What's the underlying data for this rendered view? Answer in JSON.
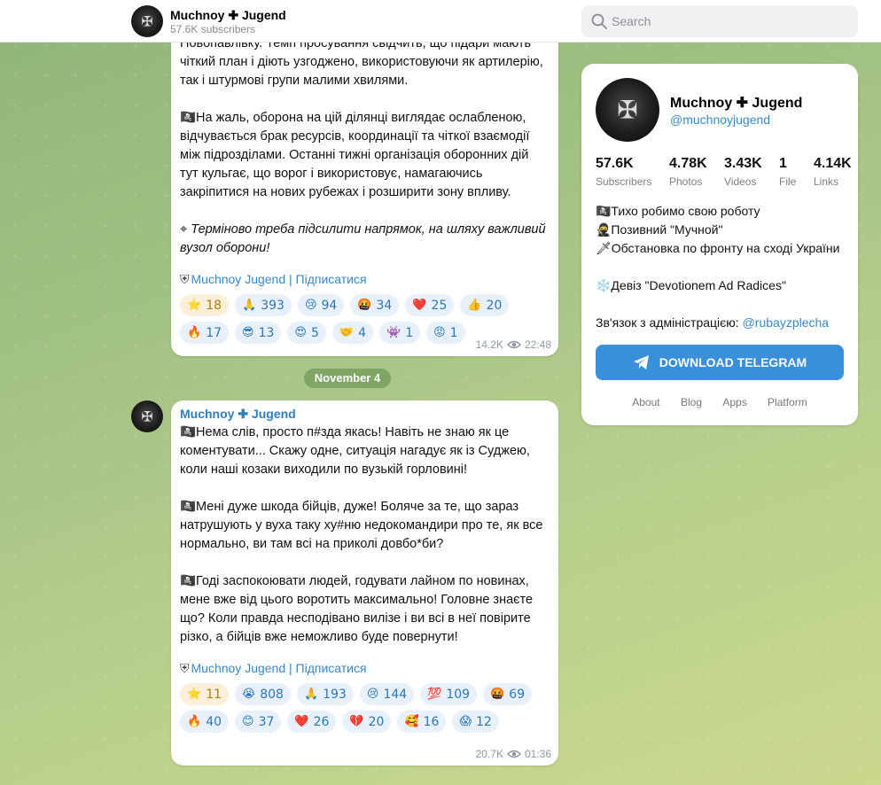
{
  "header": {
    "title": "Muchnoy ✚ Jugend",
    "subscribers": "57.6K subscribers",
    "search_placeholder": "Search"
  },
  "message1": {
    "paragraphs": [
      "Новопавлівку. Темп просування свідчить, що підари мають чіткий план і діють узгоджено, використовуючи як артилерію, так і штурмові групи малими хвилями.",
      "🏴‍☠️На жаль, оборона на цій ділянці виглядає ослабленою, відчувається брак ресурсів, координації та чіткої взаємодії між підрозділами. Останні тижні організація оборонних дій тут кульгає, що ворог і використовує, намагаючись закріпитися на нових рубежах і розширити зону впливу."
    ],
    "italic_prefix": "⌖ ",
    "italic": "Терміново треба підсилити напрямок, на шляху важливий вузол оборони!",
    "link": "Muchnoy Jugend | Підписатися",
    "reactions": [
      {
        "emoji": "⭐",
        "count": "18",
        "star": true
      },
      {
        "emoji": "🙏",
        "count": "393"
      },
      {
        "emoji": "😢",
        "count": "94"
      },
      {
        "emoji": "🤬",
        "count": "34"
      },
      {
        "emoji": "❤️",
        "count": "25"
      },
      {
        "emoji": "👍",
        "count": "20"
      },
      {
        "emoji": "🔥",
        "count": "17"
      },
      {
        "emoji": "😎",
        "count": "13"
      },
      {
        "emoji": "😍",
        "count": "5"
      },
      {
        "emoji": "🤝",
        "count": "4"
      },
      {
        "emoji": "👾",
        "count": "1"
      },
      {
        "emoji": "😡",
        "count": "1"
      }
    ],
    "views": "14.2K",
    "time": "22:48"
  },
  "date_divider": "November 4",
  "message2": {
    "author": "Muchnoy ✚ Jugend",
    "paragraphs": [
      "🏴‍☠️Нема слів, просто п#зда якась! Навіть не знаю як це коментувати... Скажу одне, ситуація нагадує як із Суджею, коли наші козаки виходили по вузькій горловині!",
      "🏴‍☠️Мені дуже шкода бійців, дуже! Боляче за те, що зараз натрушують у вуха таку ху#ню недокомандири про те, як все нормально, ви там всі на приколі довбо*би?",
      "🏴‍☠️Годі заспокоювати людей, годувати лайном по новинах, мене вже від цього воротить максимально! Головне знаєте що? Коли правда несподівано вилізе і ви всі в неї повірите різко, а бійців вже неможливо буде повернути!"
    ],
    "link": "Muchnoy Jugend | Підписатися",
    "reactions": [
      {
        "emoji": "⭐",
        "count": "11",
        "star": true
      },
      {
        "emoji": "😭",
        "count": "808"
      },
      {
        "emoji": "🙏",
        "count": "193"
      },
      {
        "emoji": "😢",
        "count": "144"
      },
      {
        "emoji": "💯",
        "count": "109"
      },
      {
        "emoji": "🤬",
        "count": "69"
      },
      {
        "emoji": "🔥",
        "count": "40"
      },
      {
        "emoji": "😊",
        "count": "37"
      },
      {
        "emoji": "❤️",
        "count": "26"
      },
      {
        "emoji": "💔",
        "count": "20"
      },
      {
        "emoji": "🥰",
        "count": "16"
      },
      {
        "emoji": "😱",
        "count": "12"
      }
    ],
    "views": "20.7K",
    "time": "01:36"
  },
  "panel": {
    "title": "Muchnoy ✚ Jugend",
    "handle": "@muchnoyjugend",
    "stats": [
      {
        "value": "57.6K",
        "label": "Subscribers"
      },
      {
        "value": "4.78K",
        "label": "Photos"
      },
      {
        "value": "3.43K",
        "label": "Videos"
      },
      {
        "value": "1",
        "label": "File"
      },
      {
        "value": "4.14K",
        "label": "Links"
      }
    ],
    "bio": [
      "🏴‍☠️Тихо робимо свою роботу",
      "🥷Позивний \"Мучной\"",
      "🗡Обстановка по фронту на сході України",
      "❄️Девіз \"Devotionem Ad Radices\""
    ],
    "contact_text": "Зв'язок з адміністрацією: ",
    "contact_link": "@rubayzplecha",
    "download_label": "DOWNLOAD TELEGRAM",
    "footer": [
      "About",
      "Blog",
      "Apps",
      "Platform"
    ]
  },
  "colors": {
    "accent": "#3a87c4",
    "button": "#3a8fdb",
    "reaction_bg": "#e8f1fb",
    "star_bg": "#fbefd9"
  },
  "icons": {
    "search": "search-icon",
    "views": "eye-icon",
    "download": "telegram-icon"
  }
}
